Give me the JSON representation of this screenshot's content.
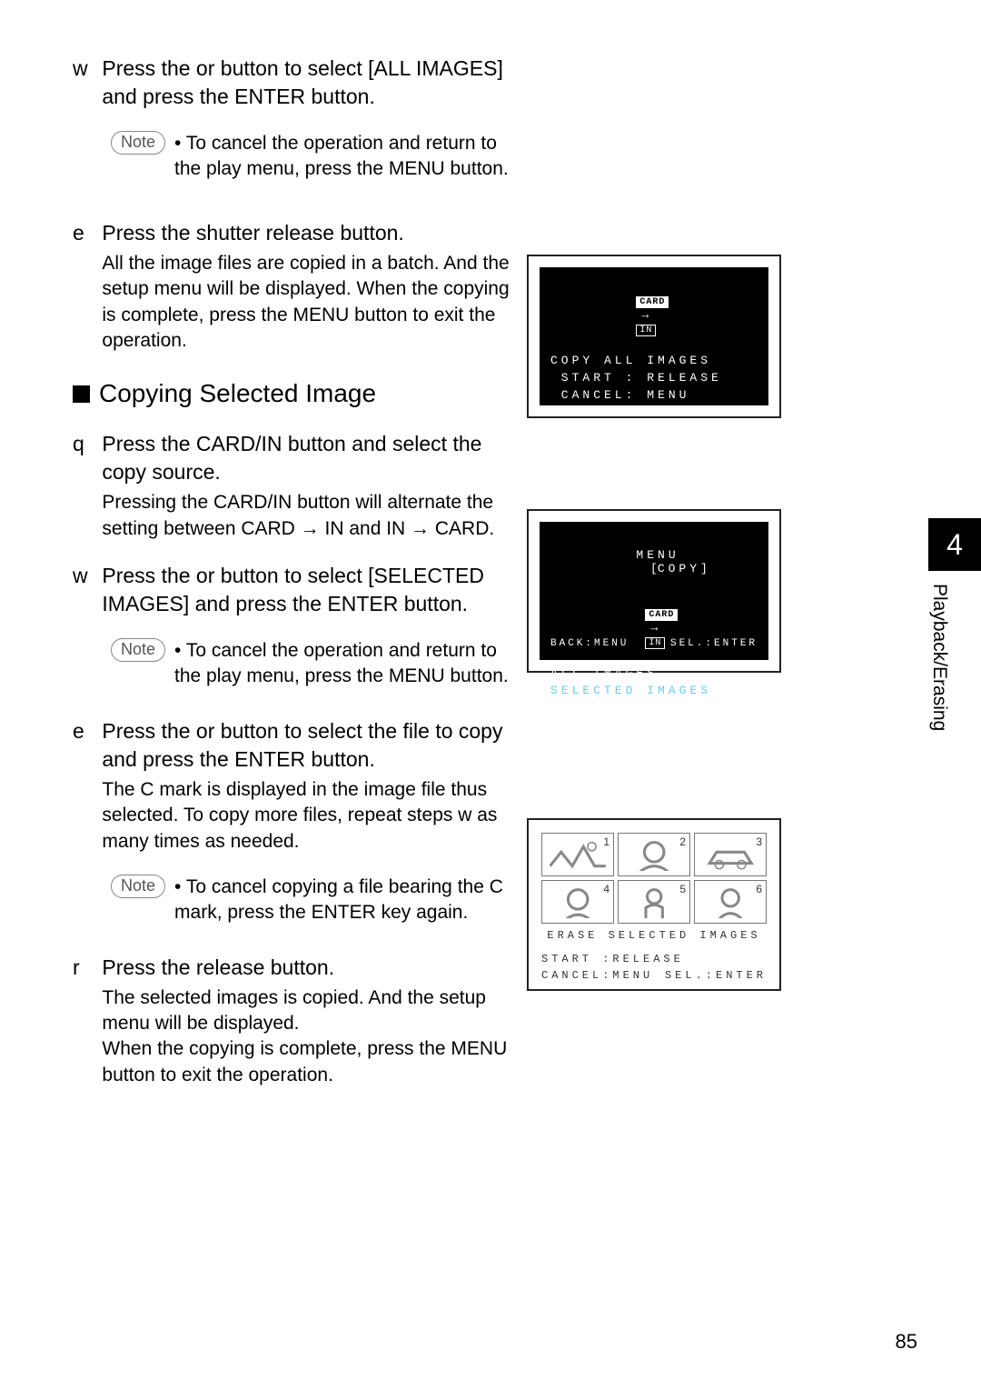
{
  "side_tab": {
    "chapter_num": "4",
    "chapter_label": "Playback/Erasing"
  },
  "page_number": "85",
  "step_w1": {
    "marker": "w",
    "main": "Press the       or      button to select [ALL IMAGES] and press the ENTER button."
  },
  "note1": {
    "badge": "Note",
    "text": "• To cancel the operation and return to the play menu, press the MENU button."
  },
  "step_e1": {
    "marker": "e",
    "main": "Press the shutter release button.",
    "sub": "All the image files are copied in a batch. And the setup menu will be displayed. When the copying is complete, press the MENU button to exit the operation."
  },
  "section_heading": "Copying Selected Image",
  "step_q": {
    "marker": "q",
    "main": "Press the CARD/IN button and select the copy source.",
    "sub": "Pressing the CARD/IN button will alternate the setting between CARD → IN and IN → CARD."
  },
  "step_w2": {
    "marker": "w",
    "main": "Press the       or      button to select [SELECTED IMAGES] and press the ENTER button."
  },
  "note2": {
    "badge": "Note",
    "text": "• To cancel the operation and return to the play menu, press the MENU button."
  },
  "step_e2": {
    "marker": "e",
    "main": "Press the       or      button to select the file to copy and press the ENTER button.",
    "sub": "The C mark is displayed in the image file thus selected.  To copy more files, repeat steps w  as many times as needed."
  },
  "note3": {
    "badge": "Note",
    "text": "• To cancel copying a file bearing the C mark, press the ENTER key again."
  },
  "step_r": {
    "marker": "r",
    "main": "Press the release button.",
    "sub": "The selected images is copied. And the setup menu will be displayed.\nWhen the copying is complete, press the MENU button to exit the operation."
  },
  "lcd1": {
    "card": "CARD",
    "in": "IN",
    "l1": "COPY ALL IMAGES",
    "l2": " START : RELEASE",
    "l3": " CANCEL: MENU"
  },
  "lcd2": {
    "header_menu": "MENU",
    "header_copy": "COPY",
    "card": "CARD",
    "in": "IN",
    "l1": "ALL IMAGES",
    "l2": "SELECTED IMAGES",
    "footer_back": "BACK:MENU",
    "footer_sel": "SEL.:ENTER"
  },
  "lcd3": {
    "title": "ERASE SELECTED IMAGES",
    "l1": "START :RELEASE",
    "l2": "CANCEL:MENU",
    "l2b": "SEL.:ENTER",
    "nums": [
      "1",
      "2",
      "3",
      "4",
      "5",
      "6"
    ]
  }
}
